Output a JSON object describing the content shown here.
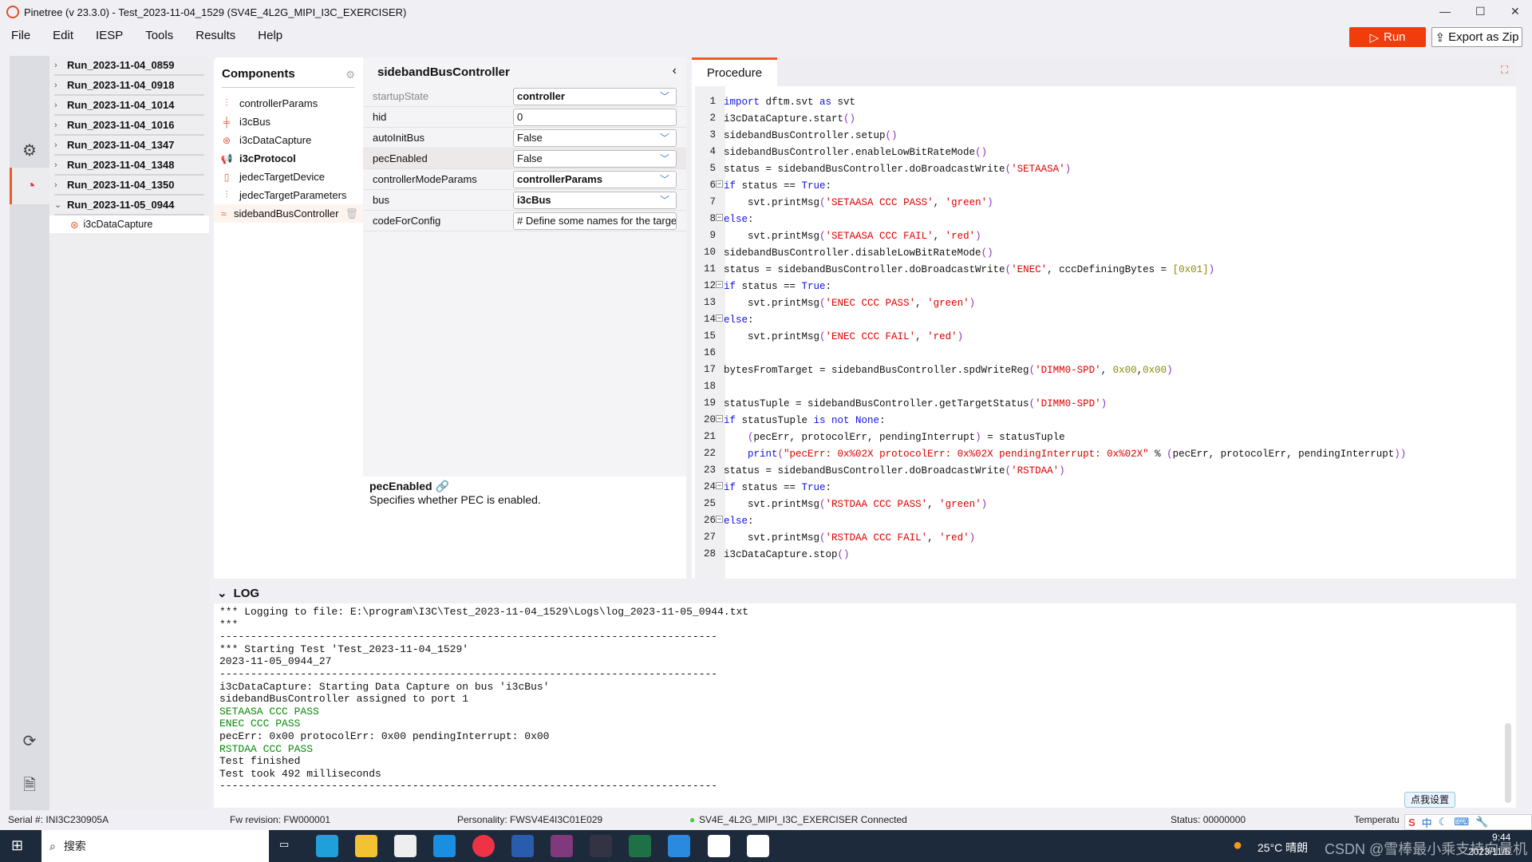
{
  "window": {
    "title": "Pinetree (v 23.3.0) - Test_2023-11-04_1529 (SV4E_4L2G_MIPI_I3C_EXERCISER)"
  },
  "menu": [
    "File",
    "Edit",
    "IESP",
    "Tools",
    "Results",
    "Help"
  ],
  "toolbar": {
    "run_label": "Run",
    "export_label": "Export as Zip"
  },
  "runs": [
    "Run_2023-11-04_0859",
    "Run_2023-11-04_0918",
    "Run_2023-11-04_1014",
    "Run_2023-11-04_1016",
    "Run_2023-11-04_1347",
    "Run_2023-11-04_1348",
    "Run_2023-11-04_1350",
    "Run_2023-11-05_0944"
  ],
  "run_child": "i3cDataCapture",
  "components": {
    "title": "Components",
    "items": [
      "controllerParams",
      "i3cBus",
      "i3cDataCapture",
      "i3cProtocol",
      "jedecTargetDevice",
      "jedecTargetParameters",
      "sidebandBusController"
    ]
  },
  "properties": {
    "title": "sidebandBusController",
    "rows": [
      {
        "label": "startupState",
        "value": "controller",
        "dropdown": true,
        "bold": true
      },
      {
        "label": "hid",
        "value": "0",
        "dropdown": false,
        "bold": false
      },
      {
        "label": "autoInitBus",
        "value": "False",
        "dropdown": true,
        "bold": false
      },
      {
        "label": "pecEnabled",
        "value": "False",
        "dropdown": true,
        "bold": false
      },
      {
        "label": "controllerModeParams",
        "value": "controllerParams",
        "dropdown": true,
        "bold": true
      },
      {
        "label": "bus",
        "value": "i3cBus",
        "dropdown": true,
        "bold": true
      },
      {
        "label": "codeForConfig",
        "value": "# Define some names for the targe",
        "dropdown": false,
        "bold": false
      }
    ],
    "description_title": "pecEnabled",
    "description": "Specifies whether PEC is enabled."
  },
  "procedure": {
    "tab": "Procedure",
    "lines": [
      [
        [
          "import",
          "k"
        ],
        [
          " dftm.svt ",
          ""
        ],
        [
          "as",
          "k"
        ],
        [
          " svt",
          ""
        ]
      ],
      [
        [
          "i3cDataCapture.start",
          ""
        ],
        [
          "()",
          "p"
        ]
      ],
      [
        [
          "sidebandBusController.setup",
          ""
        ],
        [
          "()",
          "p"
        ]
      ],
      [
        [
          "sidebandBusController.enableLowBitRateMode",
          ""
        ],
        [
          "()",
          "p"
        ]
      ],
      [
        [
          "status = sidebandBusController.doBroadcastWrite",
          ""
        ],
        [
          "(",
          "p"
        ],
        [
          "'SETAASA'",
          "s"
        ],
        [
          ")",
          "p"
        ]
      ],
      [
        [
          "if",
          "k"
        ],
        [
          " status == ",
          ""
        ],
        [
          "True",
          "k"
        ],
        [
          ":",
          ""
        ]
      ],
      [
        [
          "    svt.printMsg",
          ""
        ],
        [
          "(",
          "p"
        ],
        [
          "'SETAASA CCC PASS'",
          "s"
        ],
        [
          ", ",
          ""
        ],
        [
          "'green'",
          "s"
        ],
        [
          ")",
          "p"
        ]
      ],
      [
        [
          "else",
          "k"
        ],
        [
          ":",
          ""
        ]
      ],
      [
        [
          "    svt.printMsg",
          ""
        ],
        [
          "(",
          "p"
        ],
        [
          "'SETAASA CCC FAIL'",
          "s"
        ],
        [
          ", ",
          ""
        ],
        [
          "'red'",
          "s"
        ],
        [
          ")",
          "p"
        ]
      ],
      [
        [
          "sidebandBusController.disableLowBitRateMode",
          ""
        ],
        [
          "()",
          "p"
        ]
      ],
      [
        [
          "status = sidebandBusController.doBroadcastWrite",
          ""
        ],
        [
          "(",
          "p"
        ],
        [
          "'ENEC'",
          "s"
        ],
        [
          ", cccDefiningBytes = ",
          ""
        ],
        [
          "[0x01]",
          "n"
        ],
        [
          ")",
          "p"
        ]
      ],
      [
        [
          "if",
          "k"
        ],
        [
          " status == ",
          ""
        ],
        [
          "True",
          "k"
        ],
        [
          ":",
          ""
        ]
      ],
      [
        [
          "    svt.printMsg",
          ""
        ],
        [
          "(",
          "p"
        ],
        [
          "'ENEC CCC PASS'",
          "s"
        ],
        [
          ", ",
          ""
        ],
        [
          "'green'",
          "s"
        ],
        [
          ")",
          "p"
        ]
      ],
      [
        [
          "else",
          "k"
        ],
        [
          ":",
          ""
        ]
      ],
      [
        [
          "    svt.printMsg",
          ""
        ],
        [
          "(",
          "p"
        ],
        [
          "'ENEC CCC FAIL'",
          "s"
        ],
        [
          ", ",
          ""
        ],
        [
          "'red'",
          "s"
        ],
        [
          ")",
          "p"
        ]
      ],
      [],
      [
        [
          "bytesFromTarget = sidebandBusController.spdWriteReg",
          ""
        ],
        [
          "(",
          "p"
        ],
        [
          "'DIMM0-SPD'",
          "s"
        ],
        [
          ", ",
          ""
        ],
        [
          "0x00",
          "n"
        ],
        [
          ",",
          ""
        ],
        [
          "0x00",
          "n"
        ],
        [
          ")",
          "p"
        ]
      ],
      [],
      [
        [
          "statusTuple = sidebandBusController.getTargetStatus",
          ""
        ],
        [
          "(",
          "p"
        ],
        [
          "'DIMM0-SPD'",
          "s"
        ],
        [
          ")",
          "p"
        ]
      ],
      [
        [
          "if",
          "k"
        ],
        [
          " statusTuple ",
          ""
        ],
        [
          "is not None",
          "k"
        ],
        [
          ":",
          ""
        ]
      ],
      [
        [
          "    ",
          ""
        ],
        [
          "(",
          "p"
        ],
        [
          "pecErr, protocolErr, pendingInterrupt",
          ""
        ],
        [
          ")",
          "p"
        ],
        [
          " = statusTuple",
          ""
        ]
      ],
      [
        [
          "    ",
          ""
        ],
        [
          "print",
          "k"
        ],
        [
          "(",
          "p"
        ],
        [
          "\"pecErr: 0x%02X protocolErr: 0x%02X pendingInterrupt: 0x%02X\"",
          "s"
        ],
        [
          " % ",
          ""
        ],
        [
          "(",
          "p"
        ],
        [
          "pecErr, protocolErr, pendingInterrupt",
          ""
        ],
        [
          "))",
          "p"
        ]
      ],
      [
        [
          "status = sidebandBusController.doBroadcastWrite",
          ""
        ],
        [
          "(",
          "p"
        ],
        [
          "'RSTDAA'",
          "s"
        ],
        [
          ")",
          "p"
        ]
      ],
      [
        [
          "if",
          "k"
        ],
        [
          " status == ",
          ""
        ],
        [
          "True",
          "k"
        ],
        [
          ":",
          ""
        ]
      ],
      [
        [
          "    svt.printMsg",
          ""
        ],
        [
          "(",
          "p"
        ],
        [
          "'RSTDAA CCC PASS'",
          "s"
        ],
        [
          ", ",
          ""
        ],
        [
          "'green'",
          "s"
        ],
        [
          ")",
          "p"
        ]
      ],
      [
        [
          "else",
          "k"
        ],
        [
          ":",
          ""
        ]
      ],
      [
        [
          "    svt.printMsg",
          ""
        ],
        [
          "(",
          "p"
        ],
        [
          "'RSTDAA CCC FAIL'",
          "s"
        ],
        [
          ", ",
          ""
        ],
        [
          "'red'",
          "s"
        ],
        [
          ")",
          "p"
        ]
      ],
      [
        [
          "i3cDataCapture.stop",
          ""
        ],
        [
          "()",
          "p"
        ]
      ]
    ]
  },
  "log": {
    "title": "LOG",
    "lines": [
      {
        "t": "*** Logging to file: E:\\program\\I3C\\Test_2023-11-04_1529\\Logs\\log_2023-11-05_0944.txt",
        "c": ""
      },
      {
        "t": "***",
        "c": ""
      },
      {
        "t": "--------------------------------------------------------------------------------",
        "c": ""
      },
      {
        "t": "*** Starting Test 'Test_2023-11-04_1529'",
        "c": ""
      },
      {
        "t": "2023-11-05_0944_27",
        "c": ""
      },
      {
        "t": "--------------------------------------------------------------------------------",
        "c": ""
      },
      {
        "t": "i3cDataCapture: Starting Data Capture on bus 'i3cBus'",
        "c": ""
      },
      {
        "t": "sidebandBusController assigned to port 1",
        "c": ""
      },
      {
        "t": "SETAASA CCC PASS",
        "c": "green"
      },
      {
        "t": "ENEC CCC PASS",
        "c": "green"
      },
      {
        "t": "pecErr: 0x00 protocolErr: 0x00 pendingInterrupt: 0x00",
        "c": ""
      },
      {
        "t": "RSTDAA CCC PASS",
        "c": "green"
      },
      {
        "t": "Test finished",
        "c": ""
      },
      {
        "t": "Test took 492 milliseconds",
        "c": ""
      },
      {
        "t": "--------------------------------------------------------------------------------",
        "c": ""
      }
    ]
  },
  "status": {
    "serial": "Serial #:   INI3C230905A",
    "fw": "Fw revision: FW000001",
    "personality": "Personality: FWSV4E4I3C01E029",
    "connection": "SV4E_4L2G_MIPI_I3C_EXERCISER  Connected",
    "status": "Status: 00000000",
    "temperature": "Temperatu"
  },
  "ime": {
    "tooltip": "点我设置",
    "mode": "中"
  },
  "taskbar": {
    "search": "搜索",
    "weather": "25°C 晴朗",
    "time": "9:44",
    "date": "2023/11/5",
    "watermark": "CSDN @雪棒最小乘支持向量机"
  },
  "colors": {
    "accent": "#f05a28",
    "run": "#f33c0c",
    "keyword": "#1010f0",
    "string": "#e00000",
    "number": "#8a8a00",
    "log_pass": "#0a8a0a"
  }
}
